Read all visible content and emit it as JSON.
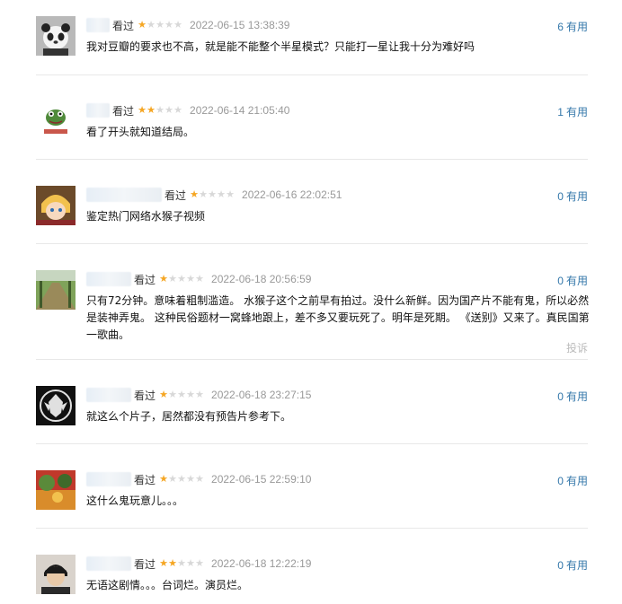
{
  "reviews": [
    {
      "status": "看过",
      "rating": 1,
      "time": "2022-06-15 13:38:39",
      "useful_count": "6",
      "useful_label": "有用",
      "text": "我对豆瓣的要求也不高，就是能不能整个半星模式？只能打一星让我十分为难好吗"
    },
    {
      "status": "看过",
      "rating": 2,
      "time": "2022-06-14 21:05:40",
      "useful_count": "1",
      "useful_label": "有用",
      "text": "看了开头就知道结局。"
    },
    {
      "status": "看过",
      "rating": 1,
      "time": "2022-06-16 22:02:51",
      "useful_count": "0",
      "useful_label": "有用",
      "text": "鉴定热门网络水猴子视频"
    },
    {
      "status": "看过",
      "rating": 1,
      "time": "2022-06-18 20:56:59",
      "useful_count": "0",
      "useful_label": "有用",
      "text": "只有72分钟。意味着粗制滥造。 水猴子这个之前早有拍过。没什么新鲜。因为国产片不能有鬼，所以必然是装神弄鬼。 这种民俗题材一窝蜂地跟上，差不多又要玩死了。明年是死期。 《送别》又来了。真民国第一歌曲。",
      "report_label": "投诉"
    },
    {
      "status": "看过",
      "rating": 1,
      "time": "2022-06-18 23:27:15",
      "useful_count": "0",
      "useful_label": "有用",
      "text": "就这么个片子，居然都没有预告片参考下。"
    },
    {
      "status": "看过",
      "rating": 1,
      "time": "2022-06-15 22:59:10",
      "useful_count": "0",
      "useful_label": "有用",
      "text": "这什么鬼玩意儿。。。"
    },
    {
      "status": "看过",
      "rating": 2,
      "time": "2022-06-18 12:22:19",
      "useful_count": "0",
      "useful_label": "有用",
      "text": "无语这剧情。。。台词烂。演员烂。"
    }
  ],
  "colors": {
    "star_on": "#f5a623",
    "star_off": "#d8d8d8",
    "link": "#3377aa",
    "time": "#999999"
  }
}
